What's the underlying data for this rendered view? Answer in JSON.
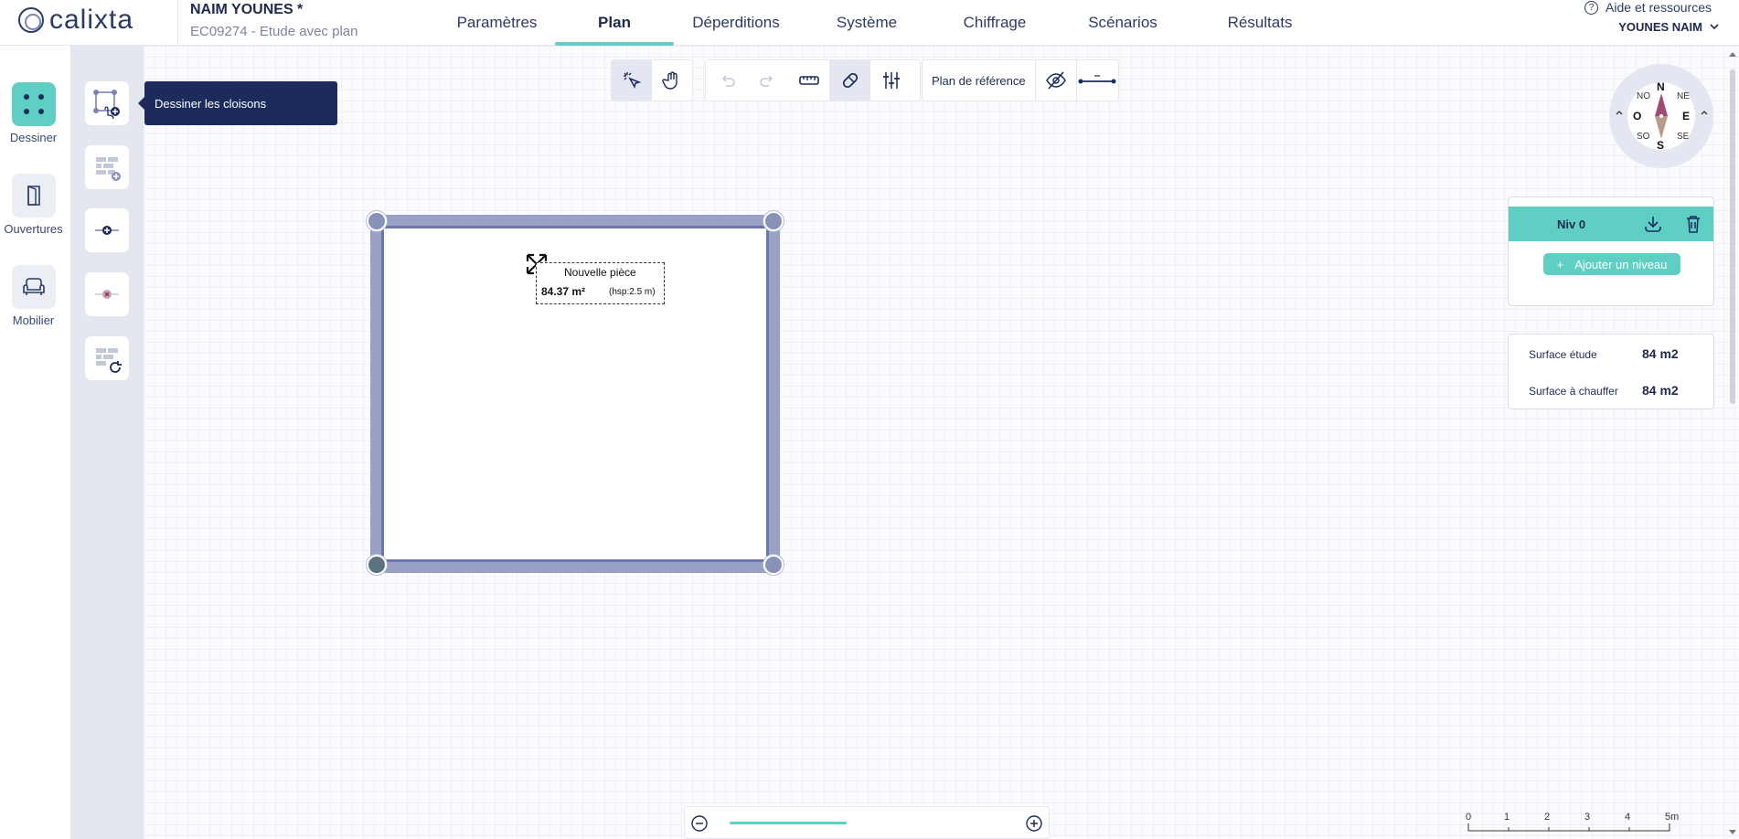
{
  "app": {
    "logo_text": "calixta"
  },
  "project": {
    "title": "NAIM YOUNES *",
    "subtitle": "EC09274 - Etude avec plan"
  },
  "nav": {
    "tabs": [
      {
        "label": "Paramètres",
        "active": false
      },
      {
        "label": "Plan",
        "active": true
      },
      {
        "label": "Déperditions",
        "active": false
      },
      {
        "label": "Système",
        "active": false
      },
      {
        "label": "Chiffrage",
        "active": false
      },
      {
        "label": "Scénarios",
        "active": false
      },
      {
        "label": "Résultats",
        "active": false
      }
    ]
  },
  "help": {
    "label": "Aide et ressources"
  },
  "user": {
    "name": "YOUNES NAIM"
  },
  "sidebar": {
    "categories": [
      {
        "label": "Dessiner",
        "icon": "draw-nodes-icon",
        "active": true
      },
      {
        "label": "Ouvertures",
        "icon": "door-icon",
        "active": false
      },
      {
        "label": "Mobilier",
        "icon": "sofa-icon",
        "active": false
      }
    ],
    "tools": [
      {
        "icon": "draw-partitions-icon"
      },
      {
        "icon": "add-wall-icon"
      },
      {
        "icon": "add-node-icon"
      },
      {
        "icon": "remove-node-icon"
      },
      {
        "icon": "rotate-wall-icon"
      }
    ],
    "tooltip": "Dessiner les cloisons"
  },
  "toolbar": {
    "reference_plan_label": "Plan de référence"
  },
  "room": {
    "name": "Nouvelle pièce",
    "area": "84.37 m²",
    "hsp": "(hsp:2.5 m)"
  },
  "compass": {
    "n": "N",
    "s": "S",
    "e": "E",
    "o": "O",
    "ne": "NE",
    "no": "NO",
    "se": "SE",
    "so": "SO"
  },
  "levels": {
    "current": "Niv 0",
    "add_label": "Ajouter un niveau"
  },
  "surfaces": {
    "etude_label": "Surface étude",
    "etude_value": "84 m2",
    "chauffer_label": "Surface à chauffer",
    "chauffer_value": "84 m2"
  },
  "scale": {
    "labels": [
      "0",
      "1",
      "2",
      "3",
      "4",
      "5m"
    ]
  },
  "colors": {
    "accent": "#5fcfc3",
    "navy": "#1d2b5c",
    "wall": "#9aa1c7"
  }
}
